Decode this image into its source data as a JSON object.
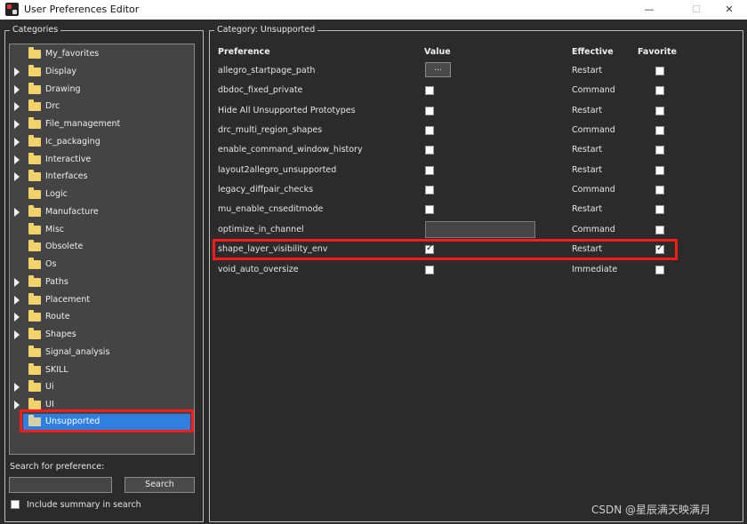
{
  "window": {
    "title": "User Preferences Editor",
    "controls": {
      "minimize": "—",
      "maximize": "☐",
      "close": "✕"
    }
  },
  "categories": {
    "legend": "Categories",
    "items": [
      {
        "label": "My_favorites",
        "expandable": false,
        "selected": false
      },
      {
        "label": "Display",
        "expandable": true,
        "selected": false
      },
      {
        "label": "Drawing",
        "expandable": true,
        "selected": false
      },
      {
        "label": "Drc",
        "expandable": true,
        "selected": false
      },
      {
        "label": "File_management",
        "expandable": true,
        "selected": false
      },
      {
        "label": "Ic_packaging",
        "expandable": true,
        "selected": false
      },
      {
        "label": "Interactive",
        "expandable": true,
        "selected": false
      },
      {
        "label": "Interfaces",
        "expandable": true,
        "selected": false
      },
      {
        "label": "Logic",
        "expandable": false,
        "selected": false
      },
      {
        "label": "Manufacture",
        "expandable": true,
        "selected": false
      },
      {
        "label": "Misc",
        "expandable": false,
        "selected": false
      },
      {
        "label": "Obsolete",
        "expandable": false,
        "selected": false
      },
      {
        "label": "Os",
        "expandable": false,
        "selected": false
      },
      {
        "label": "Paths",
        "expandable": true,
        "selected": false
      },
      {
        "label": "Placement",
        "expandable": true,
        "selected": false
      },
      {
        "label": "Route",
        "expandable": true,
        "selected": false
      },
      {
        "label": "Shapes",
        "expandable": true,
        "selected": false
      },
      {
        "label": "Signal_analysis",
        "expandable": false,
        "selected": false
      },
      {
        "label": "SKILL",
        "expandable": false,
        "selected": false
      },
      {
        "label": "Ui",
        "expandable": true,
        "selected": false
      },
      {
        "label": "UI",
        "expandable": true,
        "selected": false
      },
      {
        "label": "Unsupported",
        "expandable": false,
        "selected": true
      }
    ]
  },
  "search": {
    "label": "Search for preference:",
    "value": "",
    "button": "Search",
    "include_summary": {
      "label": "Include summary in search",
      "checked": false
    }
  },
  "category_panel": {
    "legend": "Category:  Unsupported",
    "columns": {
      "preference": "Preference",
      "value": "Value",
      "effective": "Effective",
      "favorite": "Favorite"
    },
    "rows": [
      {
        "name": "allegro_startpage_path",
        "value_type": "browse",
        "value_text": "...",
        "effective": "Restart",
        "favorite": false
      },
      {
        "name": "dbdoc_fixed_private",
        "value_type": "checkbox",
        "checked": false,
        "effective": "Command",
        "favorite": false
      },
      {
        "name": "Hide All Unsupported Prototypes",
        "value_type": "checkbox",
        "checked": false,
        "effective": "Restart",
        "favorite": false
      },
      {
        "name": "drc_multi_region_shapes",
        "value_type": "checkbox",
        "checked": false,
        "effective": "Command",
        "favorite": false
      },
      {
        "name": "enable_command_window_history",
        "value_type": "checkbox",
        "checked": false,
        "effective": "Restart",
        "favorite": false
      },
      {
        "name": "layout2allegro_unsupported",
        "value_type": "checkbox",
        "checked": false,
        "effective": "Restart",
        "favorite": false
      },
      {
        "name": "legacy_diffpair_checks",
        "value_type": "checkbox",
        "checked": false,
        "effective": "Command",
        "favorite": false
      },
      {
        "name": "mu_enable_cnseditmode",
        "value_type": "checkbox",
        "checked": false,
        "effective": "Restart",
        "favorite": false
      },
      {
        "name": "optimize_in_channel",
        "value_type": "text",
        "value_text": "",
        "effective": "Command",
        "favorite": false
      },
      {
        "name": "shape_layer_visibility_env",
        "value_type": "checkbox",
        "checked": true,
        "effective": "Restart",
        "favorite": true
      },
      {
        "name": "void_auto_oversize",
        "value_type": "checkbox",
        "checked": false,
        "effective": "Immediate",
        "favorite": false
      }
    ]
  },
  "watermark": "CSDN @星辰满天映满月",
  "colors": {
    "selection": "#2f7fe0",
    "highlight": "#ff1a1a",
    "folder": "#f2d26b",
    "background": "#2b2b2b"
  }
}
